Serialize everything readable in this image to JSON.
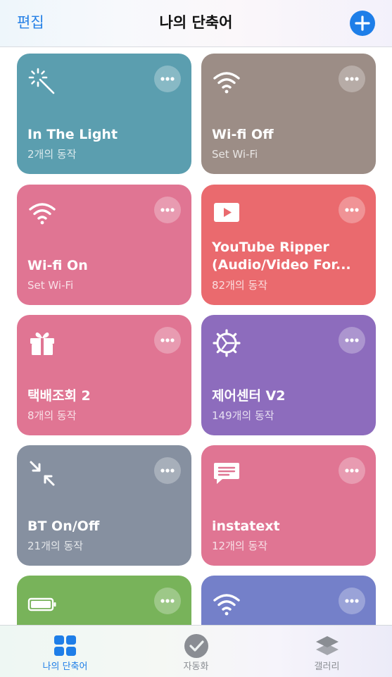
{
  "header": {
    "edit_label": "편집",
    "title": "나의 단축어",
    "add_icon": "plus-circle-icon"
  },
  "cards": [
    {
      "title": "In The Light",
      "subtitle": "2개의 동작",
      "icon": "magic-wand-icon",
      "color": "#5b9eaf"
    },
    {
      "title": "Wi-fi Off",
      "subtitle": "Set Wi-Fi",
      "icon": "wifi-icon",
      "color": "#9c8d86"
    },
    {
      "title": "Wi-fi On",
      "subtitle": "Set Wi-Fi",
      "icon": "wifi-icon",
      "color": "#e07593"
    },
    {
      "title": "YouTube Ripper (Audio/Video For...",
      "subtitle": "82개의 동작",
      "icon": "play-button-icon",
      "color": "#ea6a6e"
    },
    {
      "title": "택배조회 2",
      "subtitle": "8개의 동작",
      "icon": "gift-icon",
      "color": "#e07593"
    },
    {
      "title": "제어센터 V2",
      "subtitle": "149개의 동작",
      "icon": "gear-icon",
      "color": "#8d6cbd"
    },
    {
      "title": "BT On/Off",
      "subtitle": "21개의 동작",
      "icon": "collapse-arrows-icon",
      "color": "#8690a0"
    },
    {
      "title": "instatext",
      "subtitle": "12개의 동작",
      "icon": "speech-bubble-icon",
      "color": "#e07593"
    },
    {
      "title": "",
      "subtitle": "",
      "icon": "battery-icon",
      "color": "#78b35a"
    },
    {
      "title": "",
      "subtitle": "",
      "icon": "wifi-icon",
      "color": "#7480c9"
    }
  ],
  "tabbar": {
    "tabs": [
      {
        "label": "나의 단축어",
        "icon": "grid-icon",
        "active": true
      },
      {
        "label": "자동화",
        "icon": "checkmark-circle-icon",
        "active": false
      },
      {
        "label": "갤러리",
        "icon": "layers-icon",
        "active": false
      }
    ],
    "active_color": "#1e7ee8",
    "inactive_color": "#8a8d93"
  }
}
